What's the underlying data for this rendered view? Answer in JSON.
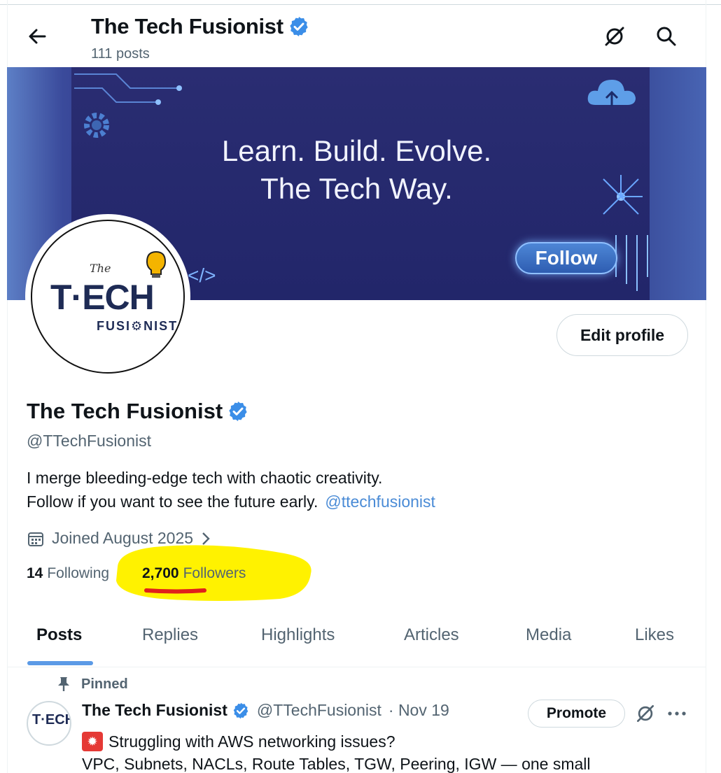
{
  "header": {
    "title": "The Tech Fusionist",
    "post_count": "111 posts"
  },
  "banner": {
    "line1": "Learn. Build. Evolve.",
    "line2": "The Tech Way.",
    "button_label": "Follow",
    "code_tag": "</>"
  },
  "avatar": {
    "logo_the": "The",
    "logo_tech": "T·ECH",
    "logo_sub": "FUSI⚙NIST"
  },
  "profile": {
    "edit_label": "Edit profile",
    "name": "The Tech Fusionist",
    "handle": "@TTechFusionist",
    "bio_line1": "I merge bleeding-edge tech with chaotic creativity.",
    "bio_line2": "Follow if you want to see the future early.",
    "bio_link": "@ttechfusionist",
    "joined": "Joined August 2025",
    "following_count": "14",
    "following_label": "Following",
    "followers_count": "2,700",
    "followers_label": "Followers"
  },
  "tabs": [
    {
      "label": "Posts",
      "active": true
    },
    {
      "label": "Replies"
    },
    {
      "label": "Highlights"
    },
    {
      "label": "Articles"
    },
    {
      "label": "Media"
    },
    {
      "label": "Likes"
    }
  ],
  "post": {
    "pinned_label": "Pinned",
    "author_name": "The Tech Fusionist",
    "author_handle": "@TTechFusionist",
    "date": "· Nov 19",
    "promote_label": "Promote",
    "text_line1": "Struggling with AWS networking issues?",
    "text_line2": "VPC, Subnets, NACLs, Route Tables, TGW, Peering, IGW — one small"
  },
  "colors": {
    "verified": "#1d9bf0",
    "link": "#4a8bd6",
    "highlight": "#fff200",
    "underline_mark": "#e0201b"
  }
}
